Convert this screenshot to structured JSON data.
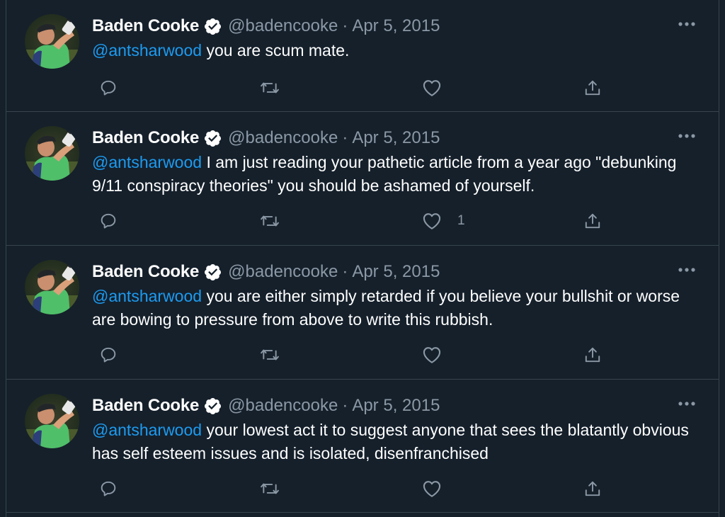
{
  "colors": {
    "background": "#15202b",
    "border": "#38444d",
    "mention": "#1d9bf0",
    "secondary_text": "#8b98a5",
    "verified_badge": "#ffffff"
  },
  "tweets": [
    {
      "name": "Baden Cooke",
      "handle": "@badencooke",
      "separator": "·",
      "date": "Apr 5, 2015",
      "mention": "@antsharwood",
      "text": " you are scum mate.",
      "like_count": ""
    },
    {
      "name": "Baden Cooke",
      "handle": "@badencooke",
      "separator": "·",
      "date": "Apr 5, 2015",
      "mention": "@antsharwood",
      "text": " I am just reading your pathetic article from a year ago \"debunking 9/11 conspiracy theories\" you should be ashamed of yourself.",
      "like_count": "1"
    },
    {
      "name": "Baden Cooke",
      "handle": "@badencooke",
      "separator": "·",
      "date": "Apr 5, 2015",
      "mention": "@antsharwood",
      "text": " you are either simply retarded if you believe your bullshit or worse are bowing to pressure from above to write this rubbish.",
      "like_count": ""
    },
    {
      "name": "Baden Cooke",
      "handle": "@badencooke",
      "separator": "·",
      "date": "Apr 5, 2015",
      "mention": "@antsharwood",
      "text": " your lowest act it to suggest anyone that sees the blatantly obvious has self esteem issues and is isolated, disenfranchised",
      "like_count": ""
    }
  ],
  "icons": {
    "verified": "verified-badge-icon",
    "more": "more-dots-icon",
    "reply": "reply-icon",
    "retweet": "retweet-icon",
    "like": "heart-icon",
    "share": "share-icon"
  }
}
